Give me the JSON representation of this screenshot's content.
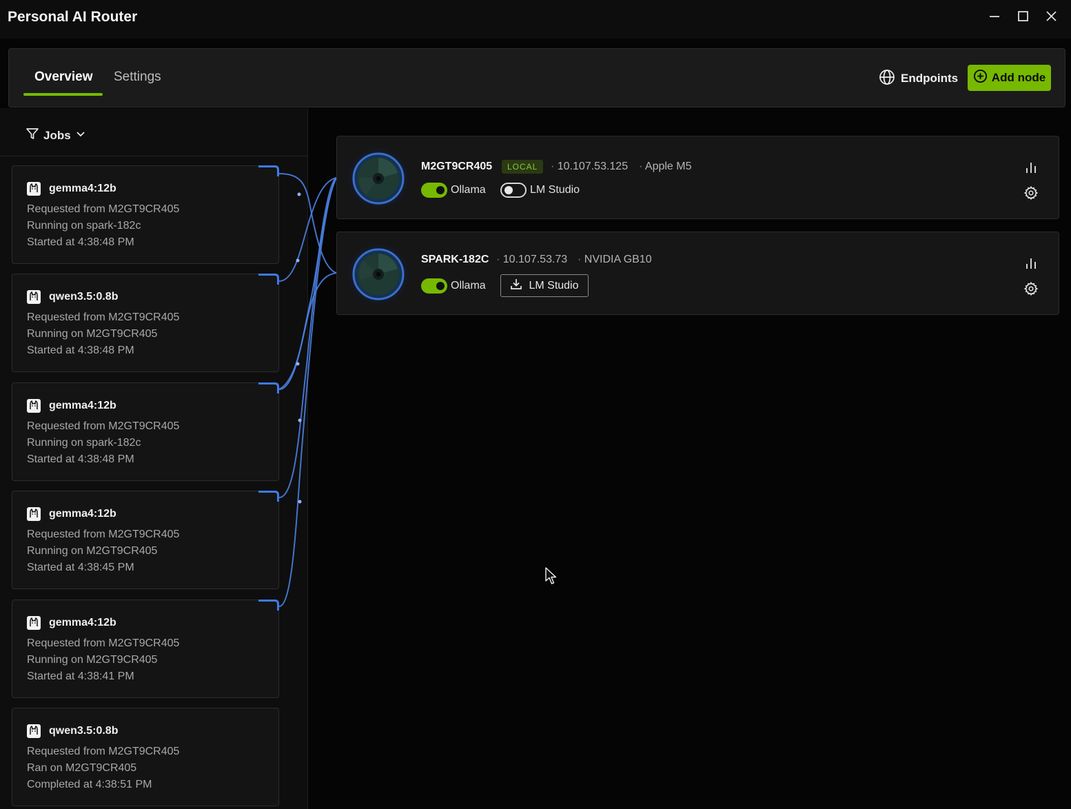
{
  "window": {
    "title": "Personal AI Router",
    "controls": [
      "minimize-icon",
      "maximize-icon",
      "close-icon"
    ]
  },
  "nav": {
    "tabs": [
      {
        "label": "Overview",
        "active": true
      },
      {
        "label": "Settings",
        "active": false
      }
    ],
    "endpoints_label": "Endpoints",
    "add_node_label": "Add node",
    "accent_color": "#76b900"
  },
  "jobs_panel": {
    "filter_label": "Jobs",
    "jobs": [
      {
        "model": "gemma4:12b",
        "requested": "Requested from M2GT9CR405",
        "status": "Running on spark-182c",
        "time": "Started at 4:38:48 PM"
      },
      {
        "model": "qwen3.5:0.8b",
        "requested": "Requested from M2GT9CR405",
        "status": "Running on M2GT9CR405",
        "time": "Started at 4:38:48 PM"
      },
      {
        "model": "gemma4:12b",
        "requested": "Requested from M2GT9CR405",
        "status": "Running on spark-182c",
        "time": "Started at 4:38:48 PM"
      },
      {
        "model": "gemma4:12b",
        "requested": "Requested from M2GT9CR405",
        "status": "Running on M2GT9CR405",
        "time": "Started at 4:38:45 PM"
      },
      {
        "model": "gemma4:12b",
        "requested": "Requested from M2GT9CR405",
        "status": "Running on M2GT9CR405",
        "time": "Started at 4:38:41 PM"
      },
      {
        "model": "qwen3.5:0.8b",
        "requested": "Requested from M2GT9CR405",
        "status": "Ran on M2GT9CR405",
        "time": "Completed at 4:38:51 PM"
      }
    ]
  },
  "nodes": [
    {
      "name": "M2GT9CR405",
      "badge": "LOCAL",
      "ip": "10.107.53.125",
      "hardware": "Apple M5",
      "ollama_label": "Ollama",
      "ollama_enabled": true,
      "lmstudio_label": "LM Studio",
      "lmstudio_enabled": false
    },
    {
      "name": "SPARK-182C",
      "ip": "10.107.53.73",
      "hardware": "NVIDIA GB10",
      "ollama_label": "Ollama",
      "ollama_enabled": true,
      "lmstudio_label": "LM Studio",
      "lmstudio_action": "download"
    }
  ],
  "separator": "·"
}
